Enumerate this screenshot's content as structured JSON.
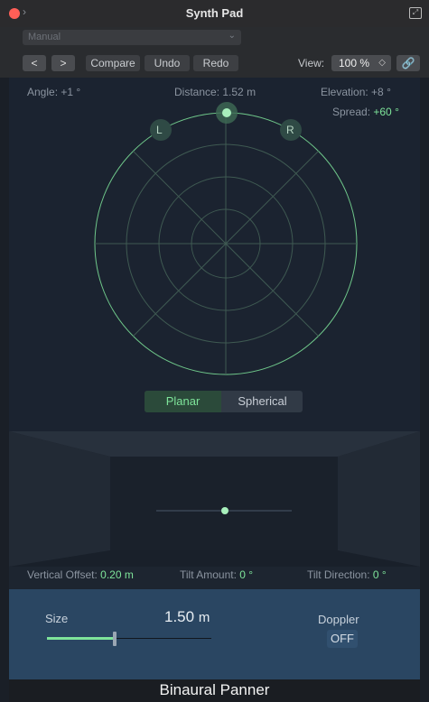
{
  "window": {
    "title": "Synth Pad"
  },
  "header": {
    "preset": "Manual",
    "nav_prev": "<",
    "nav_next": ">",
    "compare": "Compare",
    "undo": "Undo",
    "redo": "Redo",
    "view_label": "View:",
    "view_value": "100 %"
  },
  "panner": {
    "angle_label": "Angle:",
    "angle_value": "+1 °",
    "distance_label": "Distance:",
    "distance_value": "1.52 m",
    "elevation_label": "Elevation:",
    "elevation_value": "+8 °",
    "spread_label": "Spread:",
    "spread_value": "+60 °",
    "left_marker": "L",
    "right_marker": "R",
    "mode_planar": "Planar",
    "mode_spherical": "Spherical",
    "active_mode": "Planar"
  },
  "vertical": {
    "offset_label": "Vertical Offset:",
    "offset_value": "0.20 m",
    "tilt_amount_label": "Tilt Amount:",
    "tilt_amount_value": "0 °",
    "tilt_direction_label": "Tilt Direction:",
    "tilt_direction_value": "0 °"
  },
  "bottom": {
    "size_label": "Size",
    "size_value": "1.50",
    "size_unit": "m",
    "size_fraction": 0.41,
    "doppler_label": "Doppler",
    "doppler_value": "OFF"
  },
  "footer": {
    "plugin_name": "Binaural Panner"
  },
  "colors": {
    "accent": "#7ee49a",
    "panel": "#1b2330",
    "bottom": "#2a4662"
  }
}
